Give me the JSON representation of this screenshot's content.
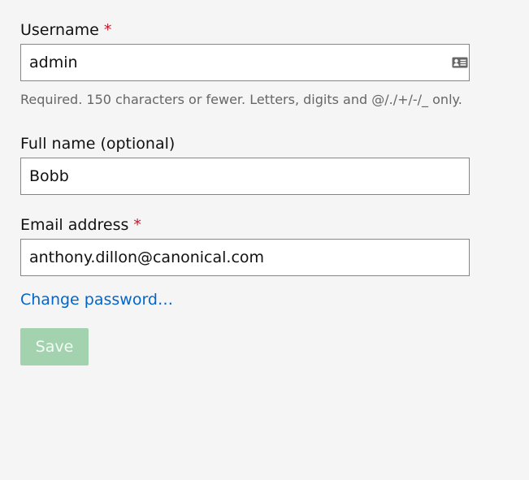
{
  "form": {
    "username": {
      "label": "Username",
      "required_mark": "*",
      "value": "admin",
      "help_text": "Required. 150 characters or fewer. Letters, digits and @/./+/-/_ only.",
      "icon": "contact-card-icon"
    },
    "full_name": {
      "label": "Full name (optional)",
      "value": "Bobb"
    },
    "email": {
      "label": "Email address",
      "required_mark": "*",
      "value": "anthony.dillon@canonical.com"
    },
    "change_password_link": "Change password…",
    "save_button": "Save"
  },
  "colors": {
    "background": "#f5f5f5",
    "required": "#c7162b",
    "link": "#0066cc",
    "save_button_disabled": "#a3d3ae",
    "help_text": "#666666"
  }
}
